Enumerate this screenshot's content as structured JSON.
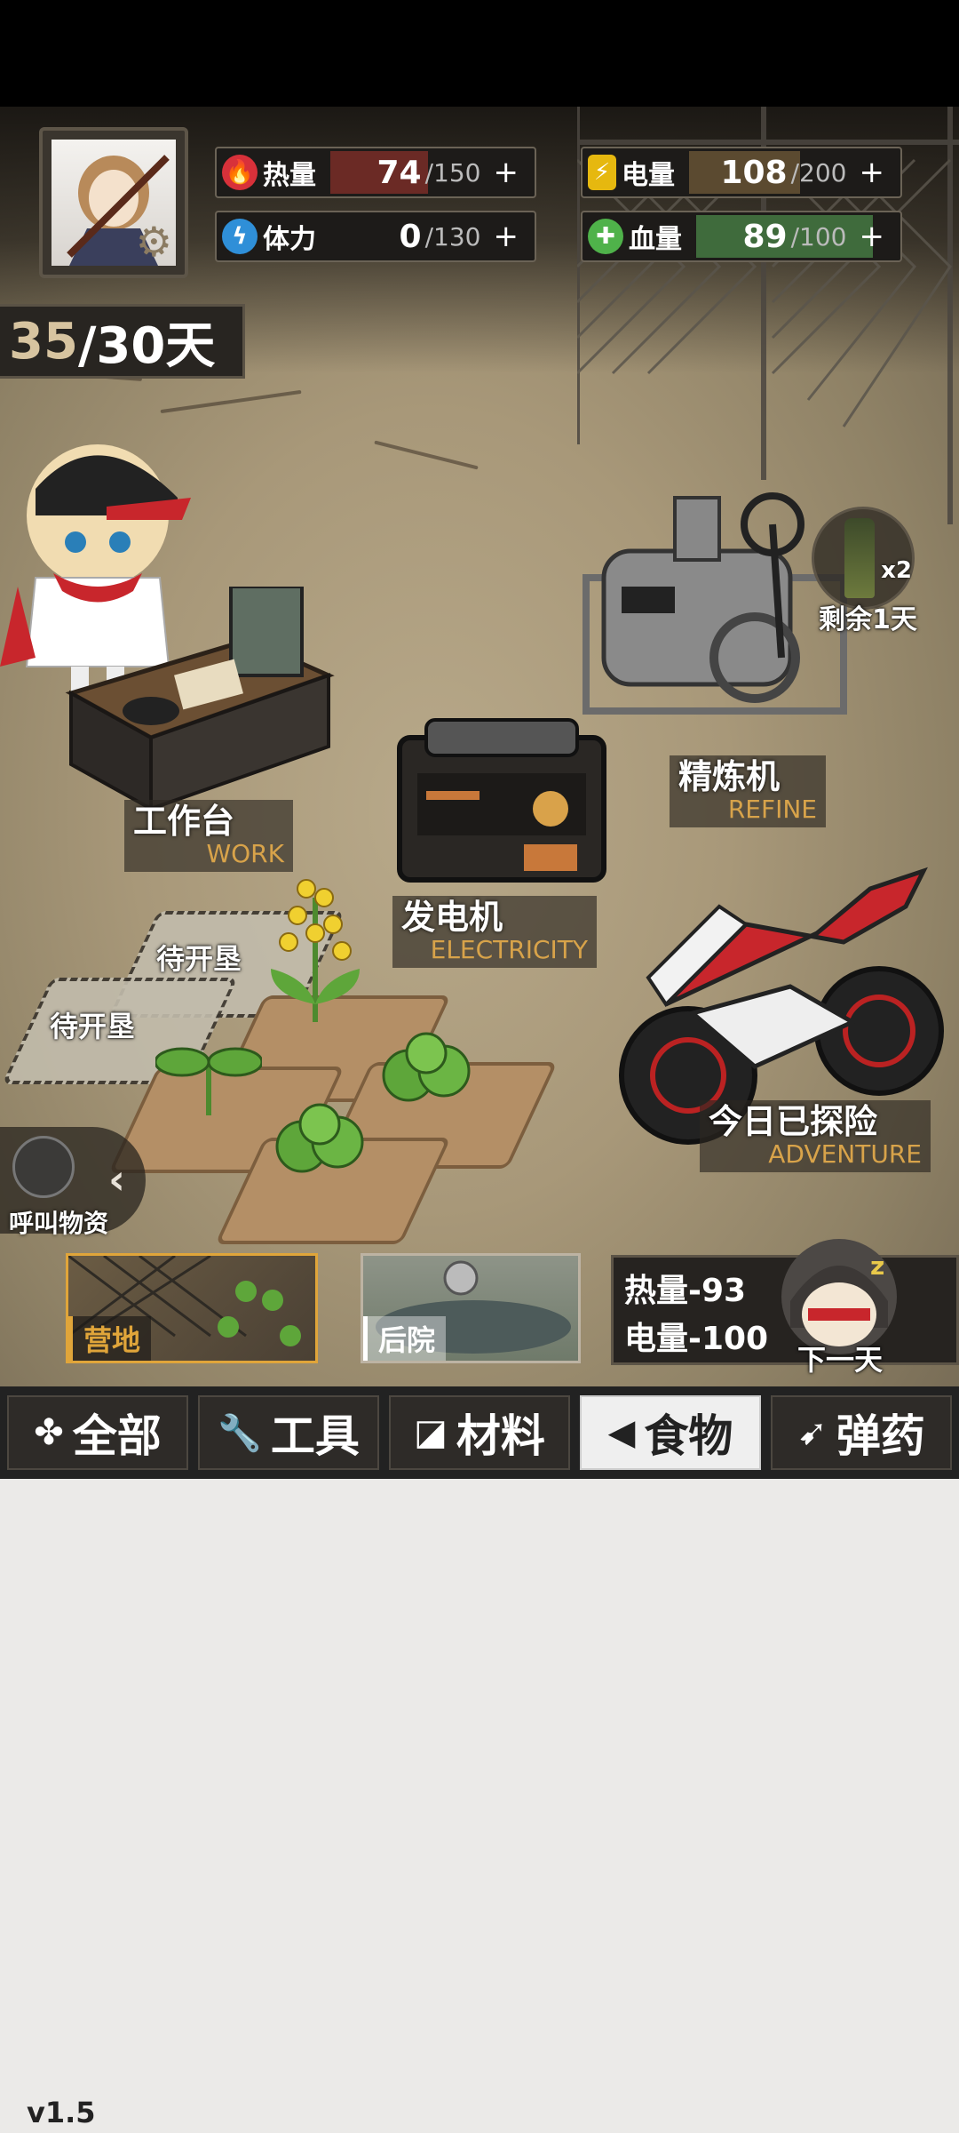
{
  "hud": {
    "stats": [
      {
        "key": "heat",
        "label": "热量",
        "value": "74",
        "max": "/150",
        "plus": "+",
        "icon": "flame-icon",
        "icon_color": "#d8313a",
        "fill_color": "#6b2a25",
        "fill_fraction": 0.49
      },
      {
        "key": "power",
        "label": "电量",
        "value": "108",
        "max": "/200",
        "plus": "+",
        "icon": "battery-icon",
        "icon_color": "#e6b80f",
        "fill_color": "#5b4a30",
        "fill_fraction": 0.54
      },
      {
        "key": "stamina",
        "label": "体力",
        "value": "0",
        "max": "/130",
        "plus": "+",
        "icon": "lightning-icon",
        "icon_color": "#2f8fd8",
        "fill_color": "#264a6a",
        "fill_fraction": 0.0
      },
      {
        "key": "health",
        "label": "血量",
        "value": "89",
        "max": "/100",
        "plus": "+",
        "icon": "health-drop-icon",
        "icon_color": "#4fb24a",
        "fill_color": "#3f6b3c",
        "fill_fraction": 0.89
      }
    ],
    "days": {
      "current": "35",
      "rest": "/30天"
    }
  },
  "buildings": {
    "work": {
      "zh": "工作台",
      "en": "WORK"
    },
    "electricity": {
      "zh": "发电机",
      "en": "ELECTRICITY"
    },
    "refine": {
      "zh": "精炼机",
      "en": "REFINE"
    },
    "adventure": {
      "zh": "今日已探险",
      "en": "ADVENTURE"
    }
  },
  "plots": {
    "pending_1": "待开垦",
    "pending_2": "待开垦"
  },
  "ration": {
    "count": "x2",
    "remaining": "剩余1天"
  },
  "call_supplies": {
    "label": "呼叫物资"
  },
  "areas": [
    {
      "label": "营地",
      "active": true
    },
    {
      "label": "后院",
      "active": false
    }
  ],
  "next_day": {
    "cost_heat": "热量-93",
    "cost_power": "电量-100",
    "label": "下一天"
  },
  "categories": [
    {
      "label": "全部",
      "icon": "clover-icon",
      "active": false
    },
    {
      "label": "工具",
      "icon": "wrench-icon",
      "active": false
    },
    {
      "label": "材料",
      "icon": "material-icon",
      "active": false
    },
    {
      "label": "食物",
      "icon": "food-icon",
      "active": true
    },
    {
      "label": "弹药",
      "icon": "ammo-icon",
      "active": false
    }
  ],
  "version": "v1.5",
  "colors": {
    "accent": "#d8a34a",
    "active_tab_border": "#e0a53a"
  }
}
